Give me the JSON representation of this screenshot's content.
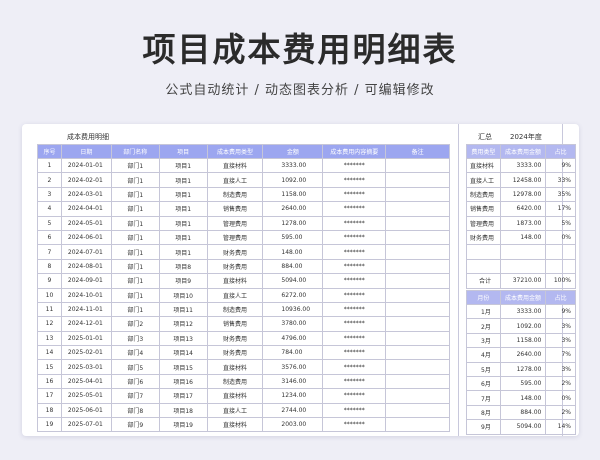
{
  "header": {
    "title": "项目成本费用明细表",
    "subtitle": "公式自动统计 / 动态图表分析 / 可编辑修改"
  },
  "main": {
    "title": "成本费用明细",
    "columns": [
      "序号",
      "日期",
      "部门名称",
      "项目",
      "成本费用类型",
      "金额",
      "成本费用内容摘要",
      "备注"
    ],
    "rows": [
      [
        "1",
        "2024-01-01",
        "部门1",
        "项目1",
        "直接材料",
        "3333.00",
        "*******",
        ""
      ],
      [
        "2",
        "2024-02-01",
        "部门1",
        "项目1",
        "直接人工",
        "1092.00",
        "*******",
        ""
      ],
      [
        "3",
        "2024-03-01",
        "部门1",
        "项目1",
        "制造费用",
        "1158.00",
        "*******",
        ""
      ],
      [
        "4",
        "2024-04-01",
        "部门1",
        "项目1",
        "销售费用",
        "2640.00",
        "*******",
        ""
      ],
      [
        "5",
        "2024-05-01",
        "部门1",
        "项目1",
        "管理费用",
        "1278.00",
        "*******",
        ""
      ],
      [
        "6",
        "2024-06-01",
        "部门1",
        "项目1",
        "管理费用",
        "595.00",
        "*******",
        ""
      ],
      [
        "7",
        "2024-07-01",
        "部门1",
        "项目1",
        "财务费用",
        "148.00",
        "*******",
        ""
      ],
      [
        "8",
        "2024-08-01",
        "部门1",
        "项目8",
        "财务费用",
        "884.00",
        "*******",
        ""
      ],
      [
        "9",
        "2024-09-01",
        "部门1",
        "项目9",
        "直接材料",
        "5094.00",
        "*******",
        ""
      ],
      [
        "10",
        "2024-10-01",
        "部门1",
        "项目10",
        "直接人工",
        "6272.00",
        "*******",
        ""
      ],
      [
        "11",
        "2024-11-01",
        "部门1",
        "项目11",
        "制造费用",
        "10936.00",
        "*******",
        ""
      ],
      [
        "12",
        "2024-12-01",
        "部门2",
        "项目12",
        "销售费用",
        "3780.00",
        "*******",
        ""
      ],
      [
        "13",
        "2025-01-01",
        "部门3",
        "项目13",
        "财务费用",
        "4796.00",
        "*******",
        ""
      ],
      [
        "14",
        "2025-02-01",
        "部门4",
        "项目14",
        "财务费用",
        "784.00",
        "*******",
        ""
      ],
      [
        "15",
        "2025-03-01",
        "部门5",
        "项目15",
        "直接材料",
        "3576.00",
        "*******",
        ""
      ],
      [
        "16",
        "2025-04-01",
        "部门6",
        "项目16",
        "制造费用",
        "3146.00",
        "*******",
        ""
      ],
      [
        "17",
        "2025-05-01",
        "部门7",
        "项目17",
        "直接材料",
        "1234.00",
        "*******",
        ""
      ],
      [
        "18",
        "2025-06-01",
        "部门8",
        "项目18",
        "直接人工",
        "2744.00",
        "*******",
        ""
      ],
      [
        "19",
        "2025-07-01",
        "部门9",
        "项目19",
        "直接材料",
        "2003.00",
        "*******",
        ""
      ]
    ]
  },
  "summary": {
    "label": "汇总",
    "year": "2024年度",
    "by_type": {
      "columns": [
        "费用类型",
        "成本费用金额",
        "占比"
      ],
      "rows": [
        [
          "直接材料",
          "3333.00",
          "9%"
        ],
        [
          "直接人工",
          "12458.00",
          "33%"
        ],
        [
          "制造费用",
          "12978.00",
          "35%"
        ],
        [
          "销售费用",
          "6420.00",
          "17%"
        ],
        [
          "管理费用",
          "1873.00",
          "5%"
        ],
        [
          "财务费用",
          "148.00",
          "0%"
        ]
      ],
      "total": [
        "合计",
        "37210.00",
        "100%"
      ]
    },
    "by_month": {
      "columns": [
        "月份",
        "成本费用金额",
        "占比"
      ],
      "rows": [
        [
          "1月",
          "3333.00",
          "9%"
        ],
        [
          "2月",
          "1092.00",
          "3%"
        ],
        [
          "3月",
          "1158.00",
          "3%"
        ],
        [
          "4月",
          "2640.00",
          "7%"
        ],
        [
          "5月",
          "1278.00",
          "3%"
        ],
        [
          "6月",
          "595.00",
          "2%"
        ],
        [
          "7月",
          "148.00",
          "0%"
        ],
        [
          "8月",
          "884.00",
          "2%"
        ],
        [
          "9月",
          "5094.00",
          "14%"
        ]
      ]
    }
  }
}
